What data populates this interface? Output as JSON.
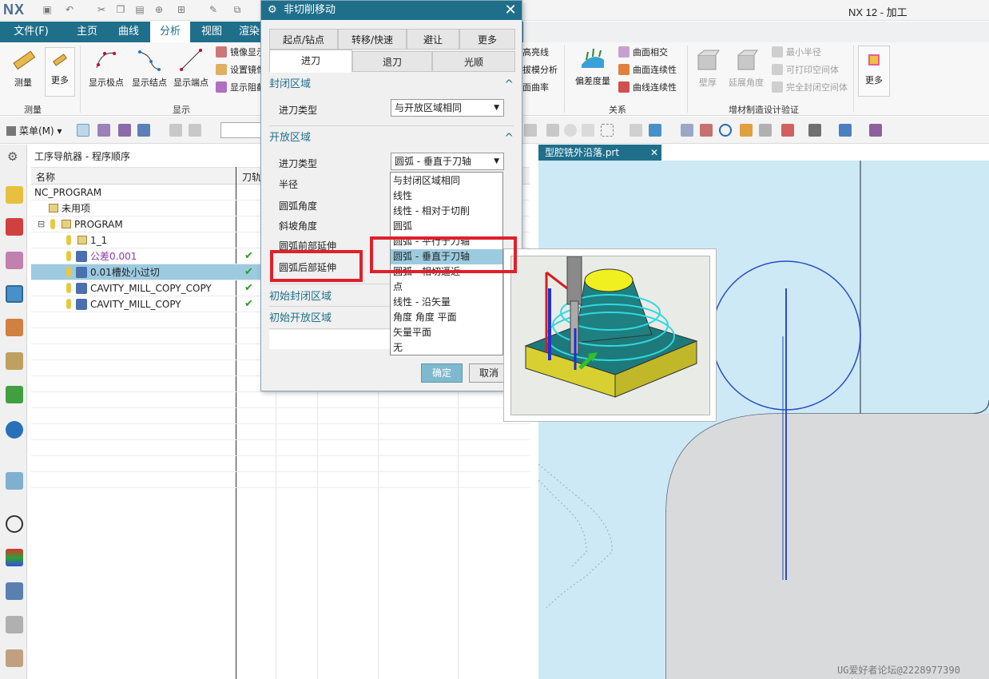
{
  "app": {
    "logo": "NX",
    "title": "NX 12 - 加工"
  },
  "ribbon_tabs": [
    "文件(F)",
    "主页",
    "曲线",
    "分析",
    "视图",
    "渲染"
  ],
  "ribbon": {
    "measure_group": {
      "label": "测量",
      "buttons": [
        "测量",
        "更多"
      ]
    },
    "display_group": {
      "label": "显示",
      "buttons": [
        "显示极点",
        "显示结点",
        "显示端点"
      ],
      "small": [
        "镜像显示",
        "设置镜像",
        "显示阻截"
      ]
    },
    "analysis_small": [
      "高亮线",
      "拔模分析",
      "面曲率"
    ],
    "relation_group": {
      "label": "关系",
      "big": "偏差度量",
      "small": [
        "曲面相交",
        "曲面连续性",
        "曲线连续性"
      ]
    },
    "additive_group": {
      "label": "增材制造设计验证",
      "big": [
        "壁厚",
        "延展角度"
      ],
      "small": [
        "最小半径",
        "可打印空间体",
        "完全封闭空间体"
      ]
    },
    "more_label": "更多",
    "menu_label": "菜单(M)"
  },
  "navigator": {
    "title": "工序导航器 - 程序顺序",
    "columns": [
      "名称",
      "刀轨"
    ],
    "rows": [
      {
        "label": "NC_PROGRAM",
        "check": ""
      },
      {
        "label": "未用项",
        "check": ""
      },
      {
        "label": "PROGRAM",
        "check": ""
      },
      {
        "label": "1_1",
        "check": ""
      },
      {
        "label": "公差0.001",
        "check": "✔"
      },
      {
        "label": "0.01槽处小过切",
        "check": "✔"
      },
      {
        "label": "CAVITY_MILL_COPY_COPY",
        "check": "✔"
      },
      {
        "label": "CAVITY_MILL_COPY",
        "check": "✔"
      }
    ]
  },
  "graphics": {
    "tab_label": "型腔铣外沿落.prt"
  },
  "dialog": {
    "title": "非切削移动",
    "tabs_row1": [
      "起点/钻点",
      "转移/快速",
      "避让",
      "更多"
    ],
    "tabs_row2": [
      "进刀",
      "退刀",
      "光顺"
    ],
    "closed_area": {
      "header": "封闭区域",
      "type_label": "进刀类型",
      "type_value": "与开放区域相同"
    },
    "open_area": {
      "header": "开放区域",
      "type_label": "进刀类型",
      "type_value": "圆弧 - 垂直于刀轴",
      "fields": [
        "半径",
        "圆弧角度",
        "斜坡角度",
        "圆弧前部延伸",
        "圆弧后部延伸"
      ]
    },
    "initial_closed": "初始封闭区域",
    "initial_open": "初始开放区域",
    "ok_label": "确定",
    "cancel_label": "取消"
  },
  "dropdown": {
    "items": [
      "与封闭区域相同",
      "线性",
      "线性 - 相对于切削",
      "圆弧",
      "圆弧 - 平行于刀轴",
      "圆弧 - 垂直于刀轴",
      "圆弧 - 相切逼近",
      "点",
      "线性 - 沿矢量",
      "角度 角度 平面",
      "矢量平面",
      "无"
    ],
    "selected_index": 5
  },
  "watermark": "UG爱好者论坛@2228977390"
}
